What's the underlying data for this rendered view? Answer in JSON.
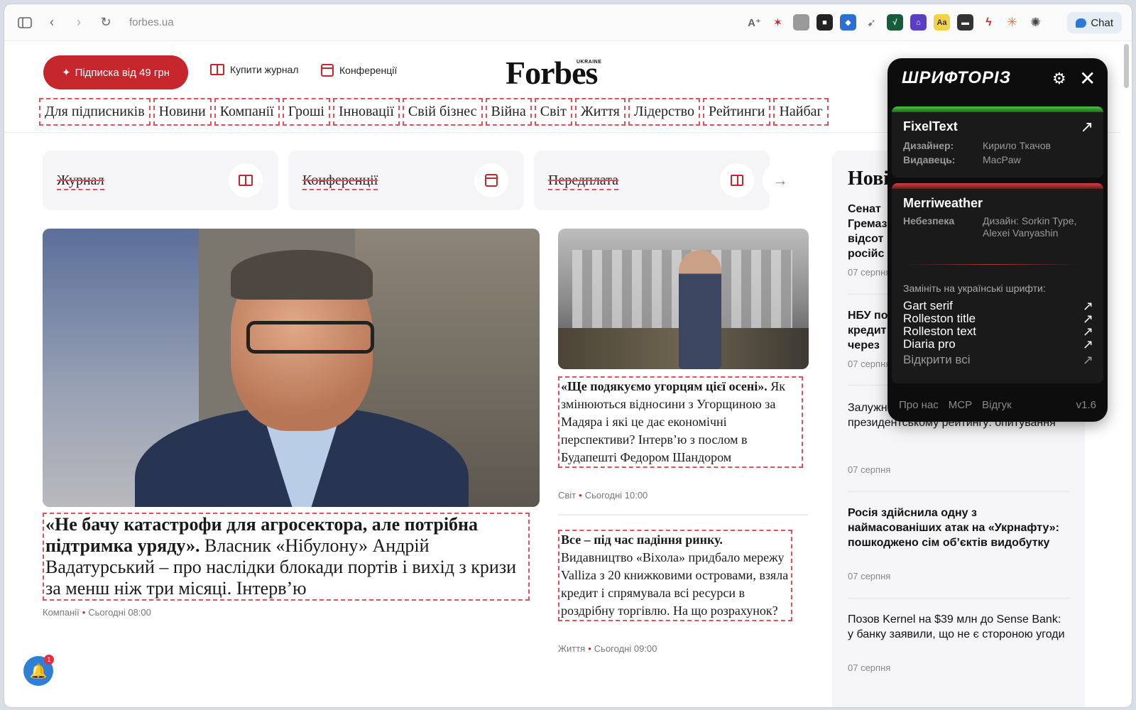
{
  "browser": {
    "url": "forbes.ua",
    "chat_label": "Chat"
  },
  "header": {
    "subscribe": "Підписка від 49 грн",
    "buy_magazine": "Купити журнал",
    "conferences": "Конференції",
    "logo": "Forbes",
    "logo_sub": "UKRAINE"
  },
  "nav": [
    "Для підписників",
    "Новини",
    "Компанії",
    "Гроші",
    "Інновації",
    "Свій бізнес",
    "Війна",
    "Світ",
    "Життя",
    "Лідерство",
    "Рейтинги",
    "Найбаг"
  ],
  "quick_cards": [
    {
      "label": "Журнал"
    },
    {
      "label": "Конференції"
    },
    {
      "label": "Передплата"
    }
  ],
  "main_article": {
    "title_bold": "«Не бачу катастрофи для агросектора, але потрібна підтримка уряду».",
    "title_rest": " Власник «Нібулону» Андрій Вадатурський – про наслідки блокади портів і вихід з кризи за менш ніж три місяці. Інтерв’ю",
    "category": "Компанії",
    "time": "Сьогодні 08:00"
  },
  "side_article_1": {
    "title_bold": "«Ще подякуємо угорцям цієї осені».",
    "title_rest": " Як змінюються відносини з Угорщиною за Мадяра і які це дає економічні перспективи? Інтерв’ю з послом в Будапешті Федором Шандором",
    "category": "Світ",
    "time": "Сьогодні 10:00"
  },
  "side_article_2": {
    "title_bold": "Все – під час падіння ринку.",
    "title_rest": " Видавництво «Віхола» придбало мережу Valliza з 20 книжковими островами, взяла кредит і спрямувала всі ресурси в роздрібну торгівлю. На що розрахунок?",
    "category": "Життя",
    "time": "Сьогодні 09:00"
  },
  "news": {
    "title": "Нові",
    "items": [
      {
        "text": "Сенат Гремаз відсот російс",
        "date": "07 серпня",
        "bold": true
      },
      {
        "text": "НБУ по кредит через",
        "date": "07 серпня",
        "bold": true
      },
      {
        "text": "Залужн українців, Зеленський – перший у президентському рейтингу: опитування",
        "date": "07 серпня",
        "bold": false
      },
      {
        "text": "Росія здійснила одну з наймасованіших атак на «Укрнафту»: пошкоджено сім об’єктів видобутку",
        "date": "07 серпня",
        "bold": true
      },
      {
        "text": "Позов Kernel на $39 млн до Sense Bank: у банку заявили, що не є стороною угоди",
        "date": "07 серпня",
        "bold": false
      }
    ]
  },
  "notification_count": "1",
  "popup": {
    "logo": "ШРИФТОРІЗ",
    "fonts": [
      {
        "name": "FixelText",
        "k1": "Дизайнер:",
        "v1": "Кирило Ткачов",
        "k2": "Видавець:",
        "v2": "MacPaw",
        "bar_color": "#3fae3a"
      },
      {
        "name": "Merriweather",
        "k1": "Небезпека",
        "v1": "Дизайн: Sorkin Type, Alexei Vanyashin",
        "bar_color": "#b8302f"
      }
    ],
    "replace_label": "Замініть на українські шрифти:",
    "replacements": [
      "Gart serif",
      "Rolleston title",
      "Rolleston text",
      "Diaria pro",
      "Відкрити всі"
    ],
    "footer": [
      "Про нас",
      "МСР",
      "Відгук"
    ],
    "version": "v1.6"
  }
}
